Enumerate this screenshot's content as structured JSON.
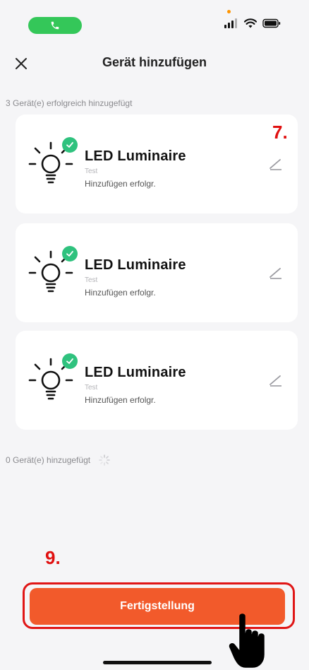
{
  "status_bar": {
    "call_indicator": "phone-icon",
    "icons": [
      "cellular-signal-icon",
      "wifi-icon",
      "battery-icon"
    ],
    "colors": {
      "call_pill": "#34c759",
      "privacy_dot": "#ff9500"
    }
  },
  "header": {
    "title": "Gerät hinzufügen",
    "close_icon": "close-icon"
  },
  "success_section": {
    "label": "3 Gerät(e) erfolgreich hinzugefügt",
    "devices": [
      {
        "name": "LED Luminaire",
        "room": "Test",
        "status": "Hinzufügen erfolgr."
      },
      {
        "name": "LED Luminaire",
        "room": "Test",
        "status": "Hinzufügen erfolgr."
      },
      {
        "name": "LED Luminaire",
        "room": "Test",
        "status": "Hinzufügen erfolgr."
      }
    ]
  },
  "pending_section": {
    "label": "0 Gerät(e) hinzugefügt",
    "icon": "loading-spinner-icon"
  },
  "annotations": {
    "step_7": "7.",
    "step_9": "9."
  },
  "footer": {
    "done_button": "Fertigstellung",
    "colors": {
      "button": "#f25a2b",
      "highlight": "#e01616",
      "success_badge": "#2fc27e"
    }
  }
}
